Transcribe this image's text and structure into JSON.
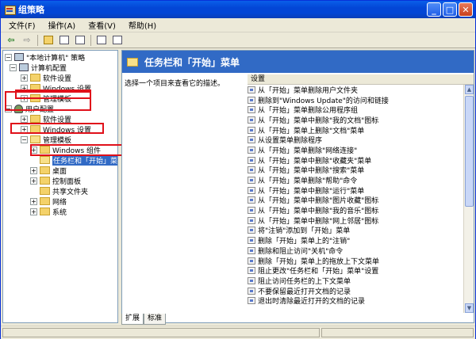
{
  "window": {
    "title": "组策略"
  },
  "menu": [
    "文件(F)",
    "操作(A)",
    "查看(V)",
    "帮助(H)"
  ],
  "tree": {
    "root": "\"本地计算机\" 策略",
    "computer_config": "计算机配置",
    "software_settings_1": "软件设置",
    "windows_settings_1": "Windows 设置",
    "admin_templates_1": "管理模板",
    "user_config": "用户配置",
    "software_settings_2": "软件设置",
    "windows_settings_2": "Windows 设置",
    "admin_templates_2": "管理模板",
    "windows_components": "Windows 组件",
    "taskbar_start": "任务栏和「开始」菜单",
    "desktop": "桌面",
    "control_panel": "控制面板",
    "shared_folders": "共享文件夹",
    "network": "网络",
    "system": "系统"
  },
  "right": {
    "header": "任务栏和「开始」菜单",
    "description": "选择一个项目来查看它的描述。",
    "column_header": "设置",
    "items": [
      "从「开始」菜单删除用户文件夹",
      "删除到\"Windows Update\"的访问和链接",
      "从「开始」菜单删除公用程序组",
      "从「开始」菜单中删除\"我的文档\"图标",
      "从「开始」菜单上删除\"文档\"菜单",
      "从设置菜单删除程序",
      "从「开始」菜单删除\"网络连接\"",
      "从「开始」菜单中删除\"收藏夹\"菜单",
      "从「开始」菜单中删除\"搜索\"菜单",
      "从「开始」菜单删除\"帮助\"命令",
      "从「开始」菜单中删除\"运行\"菜单",
      "从「开始」菜单中删除\"图片收藏\"图标",
      "从「开始」菜单中删除\"我的音乐\"图标",
      "从「开始」菜单中删除\"网上邻居\"图标",
      "将\"注销\"添加到「开始」菜单",
      "删除「开始」菜单上的\"注销\"",
      "删除和阻止访问\"关机\"命令",
      "删除「开始」菜单上的拖放上下文菜单",
      "阻止更改\"任务栏和「开始」菜单\"设置",
      "阻止访问任务栏的上下文菜单",
      "不要保留最近打开文档的记录",
      "退出时清除最近打开的文档的记录"
    ]
  },
  "tabs": [
    "扩展",
    "标准"
  ],
  "annotation_color": "#e0101a",
  "selection_color": "#316ac5"
}
